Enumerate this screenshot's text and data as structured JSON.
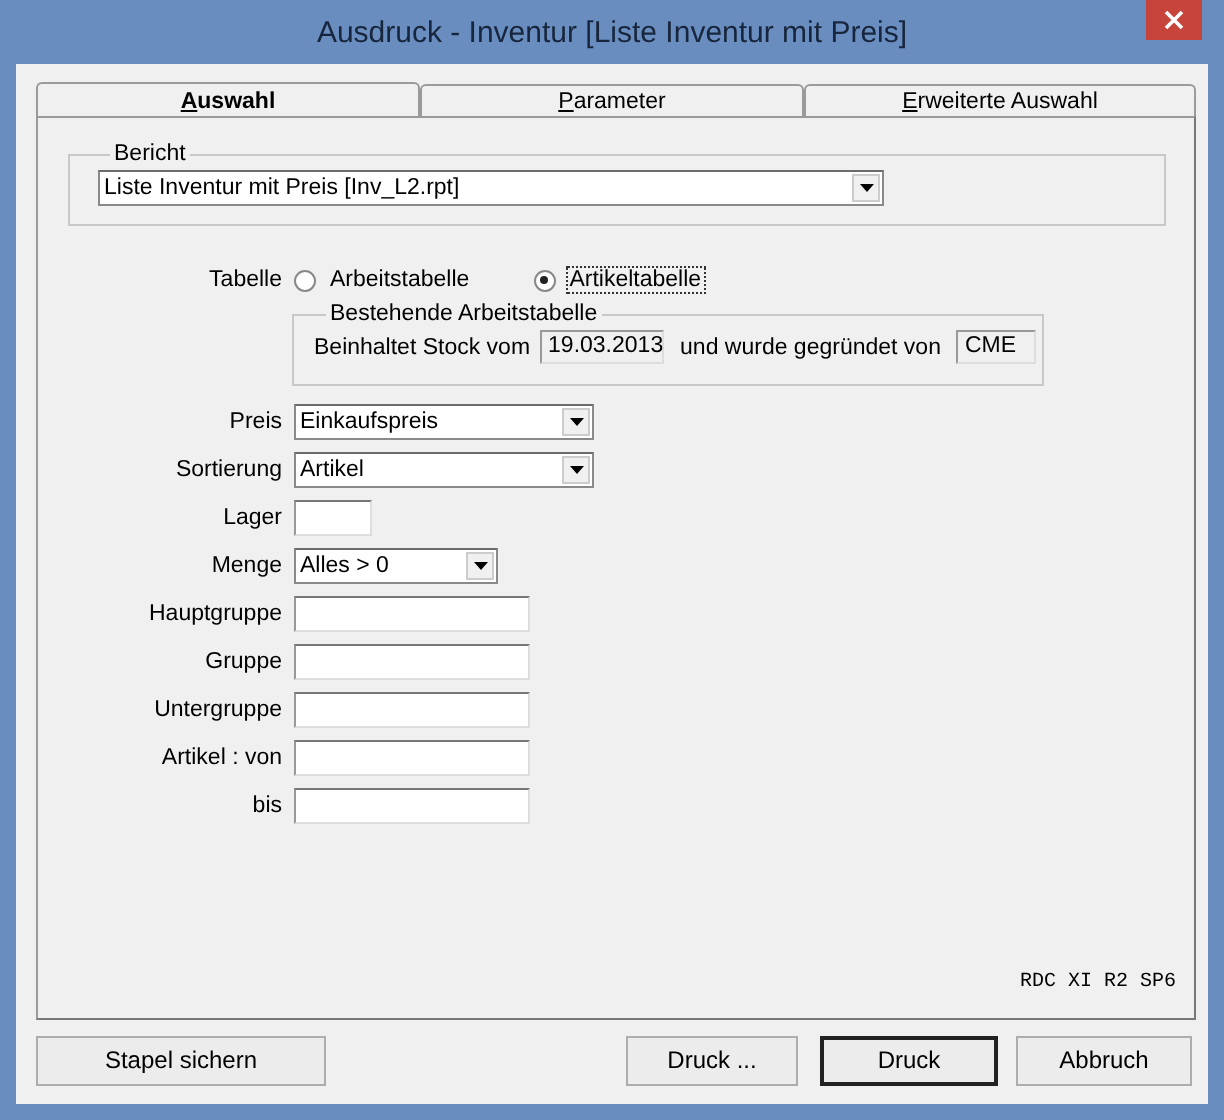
{
  "window": {
    "title": "Ausdruck - Inventur [Liste Inventur mit Preis]"
  },
  "tabs": [
    {
      "label": "Auswahl",
      "selected": true
    },
    {
      "label": "Parameter",
      "selected": false
    },
    {
      "label": "Erweiterte Auswahl",
      "selected": false
    }
  ],
  "bericht": {
    "label": "Bericht",
    "value": "Liste Inventur mit Preis [Inv_L2.rpt]"
  },
  "tabelle": {
    "label": "Tabelle",
    "options": [
      {
        "label": "Arbeitstabelle",
        "selected": false,
        "focused": false
      },
      {
        "label": "Artikeltabelle",
        "selected": true,
        "focused": true
      }
    ]
  },
  "arbeitstabelle": {
    "title": "Bestehende Arbeitstabelle",
    "text_1": "Beinhaltet Stock vom",
    "date": "19.03.2013",
    "text_2": "und wurde gegründet von",
    "user": "CME"
  },
  "fields": [
    {
      "label": "Preis",
      "kind": "dropdown",
      "value": "Einkaufspreis"
    },
    {
      "label": "Sortierung",
      "kind": "dropdown",
      "value": "Artikel"
    },
    {
      "label": "Lager",
      "kind": "text"
    },
    {
      "label": "Menge",
      "kind": "dropdown",
      "value": "Alles > 0"
    },
    {
      "label": "Hauptgruppe",
      "kind": "text"
    },
    {
      "label": "Gruppe",
      "kind": "text"
    },
    {
      "label": "Untergruppe",
      "kind": "text"
    },
    {
      "label": "Artikel : von",
      "kind": "text"
    },
    {
      "label": "bis",
      "kind": "text"
    }
  ],
  "version": "RDC XI R2 SP6",
  "buttons": [
    {
      "label": "Stapel sichern",
      "default": false
    },
    {
      "label": "Druck ...",
      "default": false
    },
    {
      "label": "Druck",
      "default": true
    },
    {
      "label": "Abbruch",
      "default": false
    }
  ]
}
